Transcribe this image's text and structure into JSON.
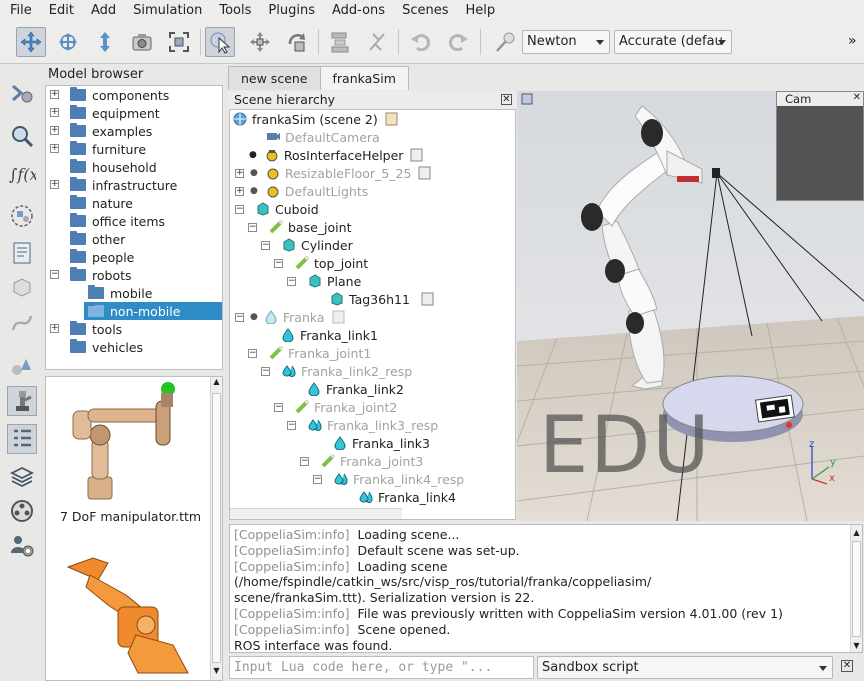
{
  "menu": [
    "File",
    "Edit",
    "Add",
    "Simulation",
    "Tools",
    "Plugins",
    "Add-ons",
    "Scenes",
    "Help"
  ],
  "toolbar": {
    "engine": "Newton",
    "accuracy": "Accurate (defau",
    "more": "»"
  },
  "model_browser": {
    "title": "Model browser",
    "items": [
      {
        "label": "components",
        "expandable": true
      },
      {
        "label": "equipment",
        "expandable": true
      },
      {
        "label": "examples",
        "expandable": true
      },
      {
        "label": "furniture",
        "expandable": true
      },
      {
        "label": "household",
        "expandable": false
      },
      {
        "label": "infrastructure",
        "expandable": true
      },
      {
        "label": "nature",
        "expandable": false
      },
      {
        "label": "office items",
        "expandable": false
      },
      {
        "label": "other",
        "expandable": false
      },
      {
        "label": "people",
        "expandable": false
      },
      {
        "label": "robots",
        "expandable": true
      },
      {
        "label": "mobile",
        "expandable": false
      },
      {
        "label": "non-mobile",
        "expandable": false
      },
      {
        "label": "tools",
        "expandable": true
      },
      {
        "label": "vehicles",
        "expandable": false
      }
    ],
    "thumbnail_label": "7 DoF manipulator.ttm"
  },
  "tabs": [
    "new scene",
    "frankaSim"
  ],
  "scene_hierarchy": {
    "title": "Scene hierarchy",
    "items": [
      {
        "label": "frankaSim (scene 2)",
        "gray": false
      },
      {
        "label": "DefaultCamera",
        "gray": true
      },
      {
        "label": "RosInterfaceHelper",
        "gray": false
      },
      {
        "label": "ResizableFloor_5_25",
        "gray": true
      },
      {
        "label": "DefaultLights",
        "gray": true
      },
      {
        "label": "Cuboid",
        "gray": false
      },
      {
        "label": "base_joint",
        "gray": false
      },
      {
        "label": "Cylinder",
        "gray": false
      },
      {
        "label": "top_joint",
        "gray": false
      },
      {
        "label": "Plane",
        "gray": false
      },
      {
        "label": "Tag36h11",
        "gray": false
      },
      {
        "label": "Franka",
        "gray": true
      },
      {
        "label": "Franka_link1",
        "gray": false
      },
      {
        "label": "Franka_joint1",
        "gray": true
      },
      {
        "label": "Franka_link2_resp",
        "gray": true
      },
      {
        "label": "Franka_link2",
        "gray": false
      },
      {
        "label": "Franka_joint2",
        "gray": true
      },
      {
        "label": "Franka_link3_resp",
        "gray": true
      },
      {
        "label": "Franka_link3",
        "gray": false
      },
      {
        "label": "Franka_joint3",
        "gray": true
      },
      {
        "label": "Franka_link4_resp",
        "gray": true
      },
      {
        "label": "Franka_link4",
        "gray": false
      }
    ]
  },
  "viewport": {
    "cam_title": "Cam",
    "watermark": "EDU",
    "axes": [
      "z",
      "y",
      "x"
    ]
  },
  "console": {
    "lines": [
      {
        "tag": "[CoppeliaSim:info]",
        "text": "Loading scene..."
      },
      {
        "tag": "[CoppeliaSim:info]",
        "text": "Default scene was set-up."
      },
      {
        "tag": "[CoppeliaSim:info]",
        "text": "Loading scene (/home/fspindle/catkin_ws/src/visp_ros/tutorial/franka/coppeliasim/"
      },
      {
        "tag": "",
        "text": "scene/frankaSim.ttt).  Serialization version is 22."
      },
      {
        "tag": "[CoppeliaSim:info]",
        "text": "File was previously written with CoppeliaSim version 4.01.00 (rev 1)"
      },
      {
        "tag": "[CoppeliaSim:info]",
        "text": "Scene opened."
      },
      {
        "tag": "",
        "text": "ROS interface was found."
      }
    ]
  },
  "lua_input": {
    "placeholder": "Input Lua code here, or type \"..."
  },
  "script_select": {
    "value": "Sandbox script"
  }
}
